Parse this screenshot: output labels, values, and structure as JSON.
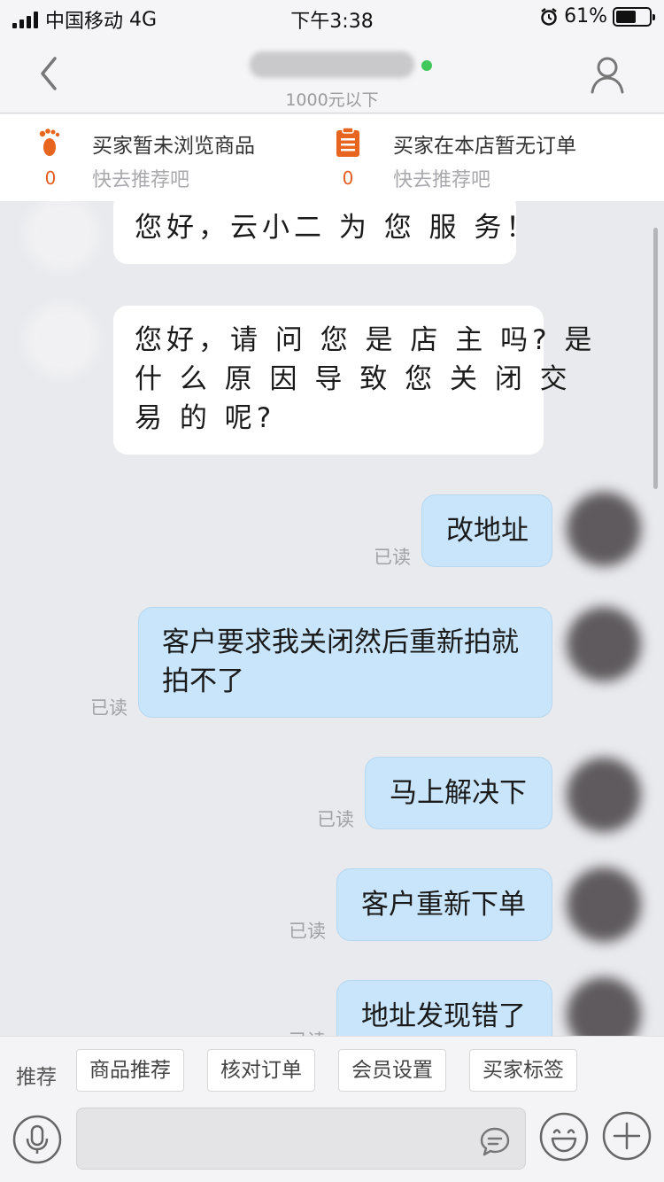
{
  "status_bar": {
    "carrier": "中国移动",
    "network": "4G",
    "time": "下午3:38",
    "battery": "61%",
    "battery_level": 0.61
  },
  "header": {
    "subtitle": "1000元以下"
  },
  "info_strip": {
    "browse": {
      "count": "0",
      "title": "买家暂未浏览商品",
      "sub": "快去推荐吧"
    },
    "order": {
      "count": "0",
      "title": "买家在本店暂无订单",
      "sub": "快去推荐吧"
    }
  },
  "chat": {
    "incoming": [
      {
        "text": "您好，云小二 为 您 服 务！"
      },
      {
        "lines": [
          "您好，请 问 您 是 店 主 吗? 是",
          "什 么 原 因 导 致 您 关 闭 交",
          "易 的 呢?"
        ]
      }
    ],
    "outgoing": [
      {
        "lines": [
          "改地址"
        ],
        "status": "已读"
      },
      {
        "lines": [
          "客户要求我关闭然后重新拍就",
          "拍不了"
        ],
        "status": "已读"
      },
      {
        "lines": [
          "马上解决下"
        ],
        "status": "已读"
      },
      {
        "lines": [
          "客户重新下单"
        ],
        "status": "已读"
      },
      {
        "lines": [
          "地址发现错了"
        ],
        "status": "已读"
      }
    ]
  },
  "bottom": {
    "recommend_label": "推荐",
    "chips": [
      "商品推荐",
      "核对订单",
      "会员设置",
      "买家标签"
    ],
    "input_value": ""
  }
}
